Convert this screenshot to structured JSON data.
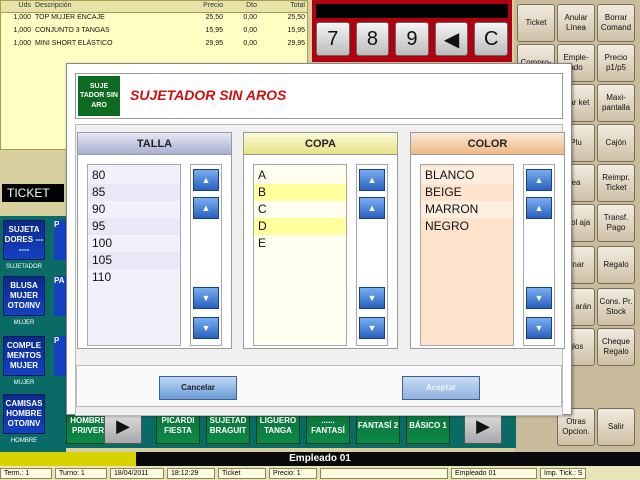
{
  "ticket": {
    "headers": [
      "Uds",
      "Descripción",
      "Precio",
      "Dto",
      "Total"
    ],
    "rows": [
      [
        "1,000",
        "TOP MUJER ENCAJE",
        "25,50",
        "0,00",
        "25,50"
      ],
      [
        "1,000",
        "CONJUNTO 3 TANGAS",
        "15,95",
        "0,00",
        "15,95"
      ],
      [
        "1,000",
        "MINI SHORT ELÁSTICO",
        "29,95",
        "0,00",
        "29,95"
      ]
    ],
    "label": "TICKET"
  },
  "numpad": {
    "keys": [
      "7",
      "8",
      "9",
      "◀",
      "C"
    ]
  },
  "right_buttons": [
    "Ticket",
    "Anular Línea",
    "Borrar Comand",
    "Compro-",
    "Emple- ado",
    "Precio p1/p5",
    "rcar ket",
    "Maxi- pantalla",
    "Plu",
    "Cajón",
    "ea",
    "Reimpr. Ticket",
    "ntrol aja",
    "Transf. Pago",
    "onar",
    "Regalo",
    "lec. arán",
    "Cons. Pr. Stock",
    "glos",
    "Cheque Regalo",
    "Otras Opcion.",
    "Salir"
  ],
  "categories": [
    {
      "label": "SUJETA DORES -------",
      "group": "SUJETADOR",
      "side": "P"
    },
    {
      "label": "BLUSA MUJER OTO/INV",
      "group": "MUJER",
      "side": "PA"
    },
    {
      "label": "COMPLE MENTOS MUJER",
      "group": "MUJER",
      "side": "P"
    },
    {
      "label": "CAMISAS HOMBRE OTO/INV",
      "group": "HOMBRE",
      "side": "PA HOMBRE PRI/VER"
    }
  ],
  "products": [
    "PICARDI FIESTA",
    "SUJETAD BRAGUIT",
    "LIGUERO TANGA",
    "...... FANTASÍ",
    "FANTASÍ 2",
    "BÁSICO 1"
  ],
  "empleado_bar": "Empleado 01",
  "status": [
    "Term.: 1",
    "Turno: 1",
    "18/04/2011",
    "18:12:29",
    "Ticket",
    "Precio: 1",
    "",
    "Empleado 01",
    "Imp. Tick.: S"
  ],
  "modal": {
    "badge": "SUJE TADOR SIN ARO",
    "title": "SUJETADOR SIN AROS",
    "talla": {
      "header": "TALLA",
      "items": [
        "80",
        "85",
        "90",
        "95",
        "100",
        "105",
        "110"
      ]
    },
    "copa": {
      "header": "COPA",
      "items": [
        "A",
        "B",
        "C",
        "D",
        "E"
      ]
    },
    "color": {
      "header": "COLOR",
      "items": [
        "BLANCO",
        "BEIGE",
        "MARRON",
        "NEGRO"
      ]
    },
    "cancel_label": "Cancelar",
    "accept_label": "Aceptar",
    "scroll_icons": {
      "top": "▲̄",
      "up": "▲",
      "down": "▼",
      "bottom": "▼̲"
    }
  },
  "colors": {
    "modal_title": "#cc1010",
    "badge_bg": "#0f6b21",
    "talla_header": "#a8afd0",
    "copa_header": "#e6e284",
    "color_header": "#f0b884"
  }
}
